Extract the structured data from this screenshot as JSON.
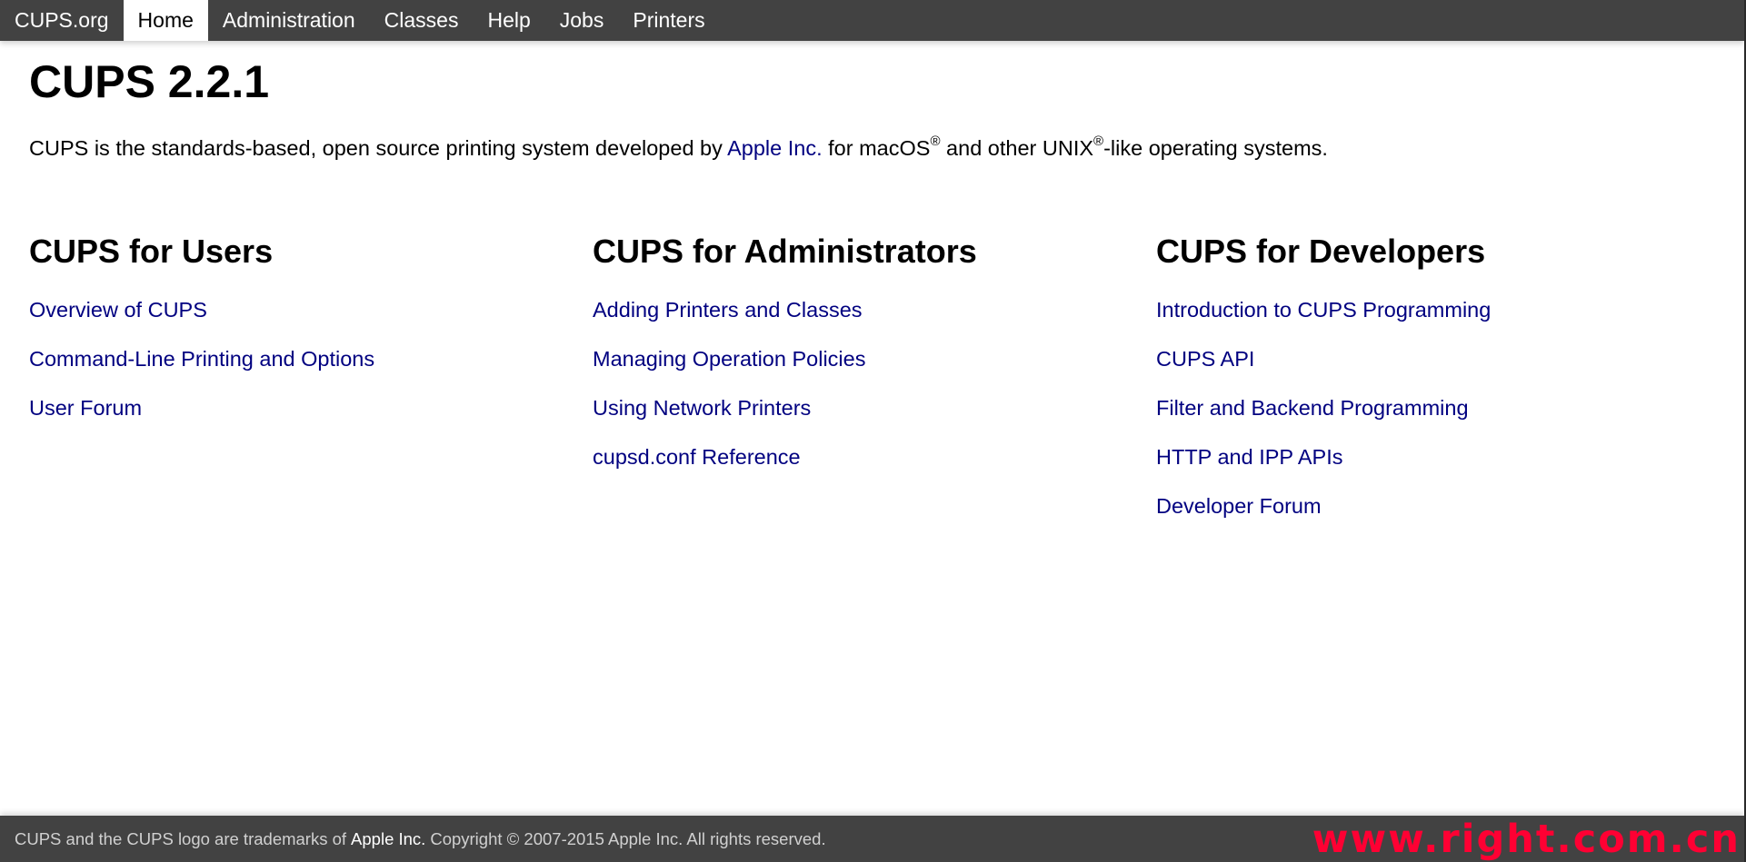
{
  "nav": {
    "brand": "CUPS.org",
    "items": [
      {
        "label": "Home",
        "active": true
      },
      {
        "label": "Administration",
        "active": false
      },
      {
        "label": "Classes",
        "active": false
      },
      {
        "label": "Help",
        "active": false
      },
      {
        "label": "Jobs",
        "active": false
      },
      {
        "label": "Printers",
        "active": false
      }
    ]
  },
  "page": {
    "title": "CUPS 2.2.1",
    "intro": {
      "part1": "CUPS is the standards-based, open source printing system developed by ",
      "link": "Apple Inc.",
      "part2": " for macOS",
      "reg1": "®",
      "part3": " and other UNIX",
      "reg2": "®",
      "part4": "-like operating systems."
    }
  },
  "sections": [
    {
      "heading": "CUPS for Users",
      "links": [
        "Overview of CUPS",
        "Command-Line Printing and Options",
        "User Forum"
      ]
    },
    {
      "heading": "CUPS for Administrators",
      "links": [
        "Adding Printers and Classes",
        "Managing Operation Policies",
        "Using Network Printers",
        "cupsd.conf Reference"
      ]
    },
    {
      "heading": "CUPS for Developers",
      "links": [
        "Introduction to CUPS Programming",
        "CUPS API",
        "Filter and Backend Programming",
        "HTTP and IPP APIs",
        "Developer Forum"
      ]
    }
  ],
  "footer": {
    "part1": "CUPS and the CUPS logo are trademarks of",
    "link": "Apple Inc.",
    "part2": "Copyright © 2007-2015 Apple Inc. All rights reserved."
  },
  "watermark": "www.right.com.cn",
  "colors": {
    "header_bg": "#424242",
    "link": "#000080",
    "watermark": "#ff0033"
  }
}
